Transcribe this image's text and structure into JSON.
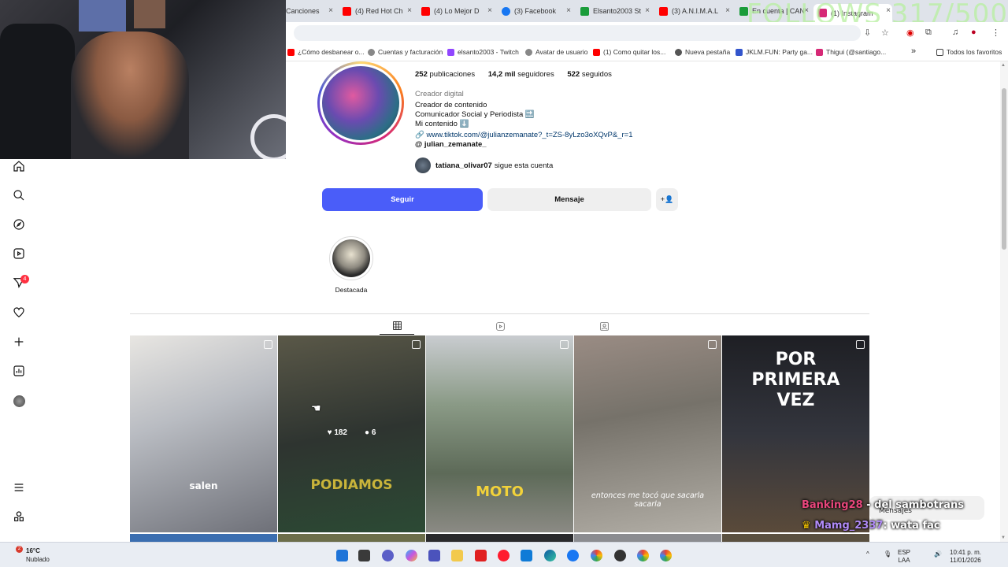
{
  "browser": {
    "tabs": [
      {
        "label": "Canciones",
        "color": "#ffffff"
      },
      {
        "label": "(4) Red Hot Ch",
        "color": "#ff0000"
      },
      {
        "label": "(4) Lo Mejor D",
        "color": "#ff0000"
      },
      {
        "label": "(3) Facebook",
        "color": "#1877f2"
      },
      {
        "label": "Elsanto2003 St",
        "color": "#1a9c3a"
      },
      {
        "label": "(3) A.N.I.M.A.L",
        "color": "#ff0000"
      },
      {
        "label": "En cuenta | CAN",
        "color": "#1a9c3a"
      },
      {
        "label": "(1) Instagram",
        "color": "#d62976"
      }
    ],
    "overlay_text": "FOLLOWS 317/500",
    "bookmarks": [
      {
        "label": "¿Cómo desbanear o...",
        "color": "#ff0000"
      },
      {
        "label": "Cuentas y facturación",
        "color": "#888888"
      },
      {
        "label": "elsanto2003 - Twitch",
        "color": "#9146ff"
      },
      {
        "label": "Avatar de usuario",
        "color": "#888888"
      },
      {
        "label": "(1) Como quitar los...",
        "color": "#ff0000"
      },
      {
        "label": "Nueva pestaña",
        "color": "#555555"
      },
      {
        "label": "JKLM.FUN: Party ga...",
        "color": "#3355cc"
      },
      {
        "label": "Thigui (@santiago...",
        "color": "#d62976"
      }
    ],
    "bookmarks_more": "»",
    "all_favorites": "Todos los favoritos"
  },
  "profile": {
    "posts_count": "252",
    "posts_label": "publicaciones",
    "followers_count": "14,2 mil",
    "followers_label": "seguidores",
    "following_count": "522",
    "following_label": "seguidos",
    "category": "Creador digital",
    "bio_lines": [
      "Creador de contenido",
      "Comunicador Social y Periodista 🔜",
      "Mi contenido ⬇️"
    ],
    "link": "🔗 www.tiktok.com/@julianzemanate?_t=ZS-8yLzo3oXQvP&_r=1",
    "threads": "@ julian_zemanate_",
    "followed_by_user": "tatiana_olivar07",
    "followed_by_text": "sigue esta cuenta",
    "follow_button": "Seguir",
    "message_button": "Mensaje",
    "suggest_icon": "+👤",
    "highlight_label": "Destacada"
  },
  "grid": {
    "tiles": [
      {
        "caption": "salen",
        "bg": "#8e9298"
      },
      {
        "caption": "PODIAMOS",
        "bg": "#3a4038",
        "likes": "182",
        "comments": "6"
      },
      {
        "caption": "MOTO",
        "bg": "#7a8a78"
      },
      {
        "caption": "entonces me tocó que sacarla sacarla",
        "bg": "#8a8880"
      },
      {
        "caption": "POR PRIMERA VEZ",
        "bg": "#3e4046"
      }
    ]
  },
  "chat": {
    "line1_user": "Banking28",
    "line1_text": "del sambotrans",
    "messages_label": "Mensajes",
    "line2_user": "Mamg_2337",
    "line2_text": ": wata fac"
  },
  "taskbar": {
    "temperature": "16°C",
    "weather_desc": "Nublado",
    "weather_badge": "2",
    "language": "ESP",
    "language2": "LAA",
    "time": "10:41 p. m.",
    "date": "11/01/2026"
  }
}
